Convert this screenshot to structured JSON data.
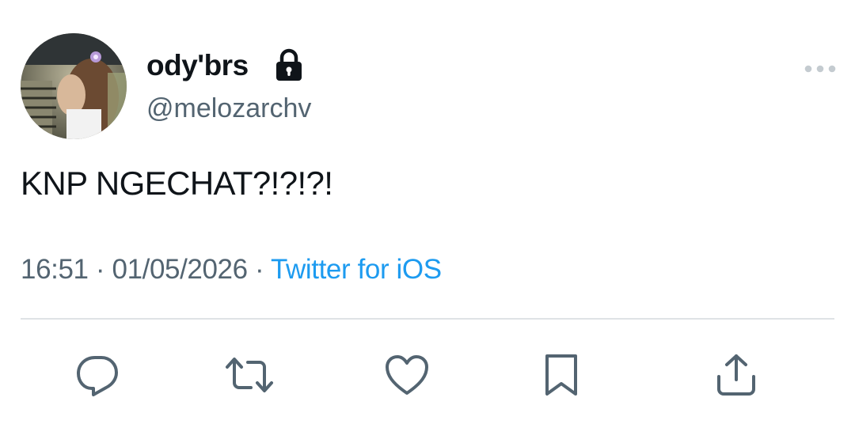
{
  "author": {
    "display_name": "ody'brs",
    "handle": "@melozarchv",
    "protected": true
  },
  "tweet": {
    "text": "KNP NGECHAT?!?!?!"
  },
  "meta": {
    "time": "16:51",
    "separator": "·",
    "date": "01/05/2026",
    "source": "Twitter for iOS"
  },
  "actions": [
    {
      "name": "reply",
      "icon": "reply-icon"
    },
    {
      "name": "retweet",
      "icon": "retweet-icon"
    },
    {
      "name": "like",
      "icon": "heart-icon"
    },
    {
      "name": "bookmark",
      "icon": "bookmark-icon"
    },
    {
      "name": "share",
      "icon": "share-icon"
    }
  ],
  "colors": {
    "text": "#0f1419",
    "secondary": "#536471",
    "link": "#1d9bf0",
    "divider": "#dfe3e6"
  }
}
